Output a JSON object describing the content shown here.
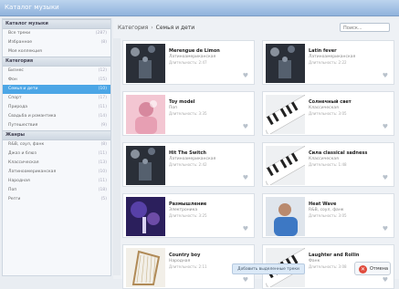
{
  "window": {
    "title": "Каталог музыки"
  },
  "sidebar": {
    "sections": [
      {
        "header": "Каталог музыки",
        "items": [
          {
            "label": "Все треки",
            "count": "(287)"
          },
          {
            "label": "Избранное",
            "count": "(8)"
          },
          {
            "label": "Моя коллекция",
            "count": ""
          }
        ]
      },
      {
        "header": "Категория",
        "items": [
          {
            "label": "Бизнес",
            "count": "(12)"
          },
          {
            "label": "Фон",
            "count": "(15)"
          },
          {
            "label": "Семья и дети",
            "count": "(10)",
            "active": true
          },
          {
            "label": "Спорт",
            "count": "(17)"
          },
          {
            "label": "Природа",
            "count": "(11)"
          },
          {
            "label": "Свадьба и романтика",
            "count": "(14)"
          },
          {
            "label": "Путешествия",
            "count": "(9)"
          }
        ]
      },
      {
        "header": "Жанры",
        "items": [
          {
            "label": "R&B, соул, фанк",
            "count": "(8)"
          },
          {
            "label": "Джаз и блюз",
            "count": "(11)"
          },
          {
            "label": "Классическая",
            "count": "(13)"
          },
          {
            "label": "Латиноамериканская",
            "count": "(10)"
          },
          {
            "label": "Народная",
            "count": "(11)"
          },
          {
            "label": "Поп",
            "count": "(18)"
          },
          {
            "label": "Регги",
            "count": "(5)"
          }
        ]
      }
    ]
  },
  "main": {
    "breadcrumb": {
      "root": "Категория",
      "current": "Семья и дети"
    },
    "search": {
      "placeholder": "Поиск..."
    },
    "cards": [
      {
        "title": "Merengue de Limon",
        "genre": "Латиноамериканская",
        "duration": "Длительность: 2:47",
        "theme": "dark-lights",
        "col": 0,
        "row": 0
      },
      {
        "title": "Latin fever",
        "genre": "Латиноамериканская",
        "duration": "Длительность: 2:22",
        "theme": "dark-lights",
        "col": 1,
        "row": 0
      },
      {
        "title": "Toy model",
        "genre": "Поп",
        "duration": "Длительность: 3:35",
        "theme": "pink-portrait",
        "col": 0,
        "row": 1
      },
      {
        "title": "Солнечный свет",
        "genre": "Классическая",
        "duration": "Длительность: 3:05",
        "theme": "piano",
        "col": 1,
        "row": 1
      },
      {
        "title": "Hit The Switch",
        "genre": "Латиноамериканская",
        "duration": "Длительность: 2:42",
        "theme": "dark-lights",
        "col": 0,
        "row": 2
      },
      {
        "title": "Сила classical sadness",
        "genre": "Классическая",
        "duration": "Длительность: 1:48",
        "theme": "piano",
        "col": 1,
        "row": 2
      },
      {
        "title": "Размышление",
        "genre": "Электроника",
        "duration": "Длительность: 3:25",
        "theme": "purple-stage",
        "col": 0,
        "row": 3
      },
      {
        "title": "Heat Wave",
        "genre": "R&B, соул, фанк",
        "duration": "Длительность: 3:05",
        "theme": "portrait-blue",
        "col": 1,
        "row": 3
      },
      {
        "title": "Country boy",
        "genre": "Народная",
        "duration": "Длительность: 2:11",
        "theme": "harp",
        "col": 0,
        "row": 4
      },
      {
        "title": "Laughter and Rollin",
        "genre": "Фанк",
        "duration": "Длительность: 3:08",
        "theme": "piano",
        "col": 1,
        "row": 4
      }
    ],
    "heart_icon": "heart-icon"
  },
  "footer": {
    "add_label": "Добавить выделенные треки",
    "cancel_label": "Отмена"
  },
  "colors": {
    "accent": "#4ca6e6",
    "title_bar": "#8fb2dc",
    "cancel": "#e04a3c"
  }
}
